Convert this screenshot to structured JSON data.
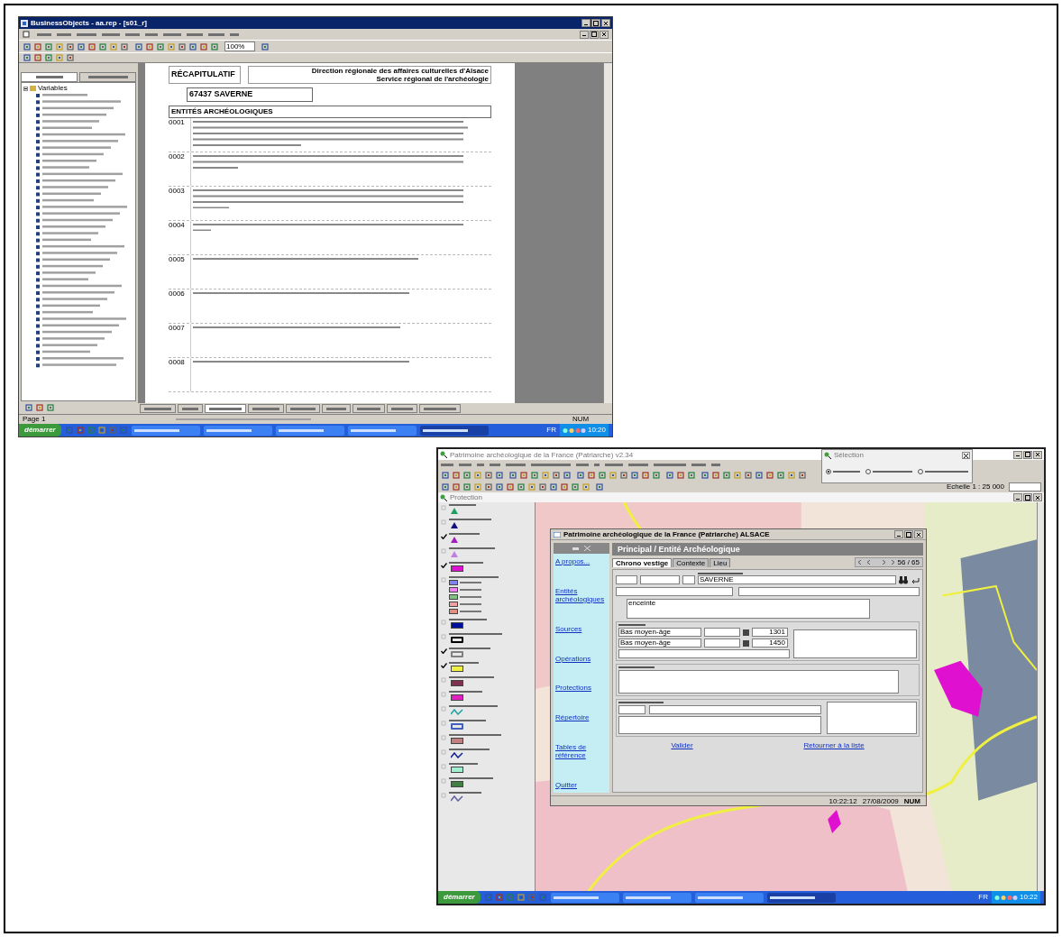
{
  "report_window": {
    "title": "BusinessObjects - aa.rep - [s01_r]",
    "zoom": "100%",
    "tree_root": "Variables",
    "report": {
      "title": "RÉCAPITULATIF",
      "header_lines": [
        "Direction régionale des affaires culturelles d'Alsace",
        "Service régional de l'archéologie"
      ],
      "commune": "67437 SAVERNE",
      "section": "ENTITÉS ARCHÉOLOGIQUES",
      "rows": [
        {
          "code": "0001"
        },
        {
          "code": "0002"
        },
        {
          "code": "0003"
        },
        {
          "code": "0004"
        },
        {
          "code": "0005"
        },
        {
          "code": "0006"
        },
        {
          "code": "0007"
        },
        {
          "code": "0008"
        }
      ]
    },
    "report_tabs": [
      {
        "selected": false
      },
      {
        "selected": false
      },
      {
        "selected": true
      },
      {
        "selected": false
      },
      {
        "selected": false
      },
      {
        "selected": false
      },
      {
        "selected": false
      },
      {
        "selected": false
      },
      {
        "selected": false
      }
    ],
    "status_bar": {
      "page": "Page 1",
      "num": "NUM"
    },
    "taskbar": {
      "start": "démarrer",
      "lang": "FR",
      "clock": "10:20"
    }
  },
  "gis_window": {
    "title": "Patrimoine archéologique de la France (Patriarche) v2.34",
    "selection": {
      "title": "Sélection",
      "options": [
        {
          "selected": true
        },
        {
          "selected": false
        },
        {
          "selected": false
        }
      ]
    },
    "scale": "Echelle 1 : 25 000",
    "layer_window_title": "Protection",
    "legend": [
      {
        "checked": false,
        "kind": "triangle",
        "color": "#20a060"
      },
      {
        "checked": false,
        "kind": "triangle",
        "color": "#101080"
      },
      {
        "checked": true,
        "kind": "triangle",
        "color": "#a020c0"
      },
      {
        "checked": false,
        "kind": "triangle",
        "color": "#c080e0"
      },
      {
        "checked": true,
        "kind": "fill",
        "color": "#e010d0"
      },
      {
        "checked": false,
        "kind": "group",
        "children": [
          {
            "color": "#8080f0"
          },
          {
            "color": "#f080f0"
          },
          {
            "color": "#80c080"
          },
          {
            "color": "#f0a0a0"
          },
          {
            "color": "#e09080"
          }
        ]
      },
      {
        "checked": false,
        "kind": "fill",
        "color": "#0010a0"
      },
      {
        "checked": false,
        "kind": "outline",
        "color": "#000000"
      },
      {
        "checked": true,
        "kind": "outline",
        "color": "#808080"
      },
      {
        "checked": true,
        "kind": "fill",
        "color": "#f0f040"
      },
      {
        "checked": false,
        "kind": "fill",
        "color": "#803050"
      },
      {
        "checked": false,
        "kind": "fill",
        "color": "#e020c0"
      },
      {
        "checked": false,
        "kind": "line",
        "color": "#20a0a0"
      },
      {
        "checked": false,
        "kind": "outline",
        "color": "#4060c0"
      },
      {
        "checked": false,
        "kind": "fill",
        "color": "#c08080"
      },
      {
        "checked": false,
        "kind": "line",
        "color": "#102090"
      },
      {
        "checked": false,
        "kind": "fill",
        "color": "#a0f0d0"
      },
      {
        "checked": false,
        "kind": "fill",
        "color": "#408040"
      },
      {
        "checked": false,
        "kind": "line",
        "color": "#6060a0"
      }
    ],
    "dialog": {
      "title": "Patrimoine archéologique de la France (Patriarche) ALSACE",
      "nav_links": [
        "A propos...",
        "Entités archéologiques",
        "Sources",
        "Opérations",
        "Protections",
        "Répertoire",
        "Tables de référence",
        "Quitter"
      ],
      "heading": "Principal / Entité Archéologique",
      "tabs": [
        {
          "label": "Chrono vestige",
          "selected": true
        },
        {
          "label": "Contexte",
          "selected": false
        },
        {
          "label": "Lieu",
          "selected": false
        }
      ],
      "record": "56 / 65",
      "commune": "SAVERNE",
      "interpretation": "enceinte",
      "chronology": [
        {
          "period": "Bas moyen-âge",
          "year": "1301"
        },
        {
          "period": "Bas moyen-âge",
          "year": "1450"
        }
      ],
      "actions": [
        "Valider",
        "Retourner à la liste"
      ],
      "status": [
        "10:22:12",
        "27/08/2009",
        "NUM"
      ]
    },
    "taskbar": {
      "start": "démarrer",
      "lang": "FR",
      "clock": "10:22"
    }
  }
}
